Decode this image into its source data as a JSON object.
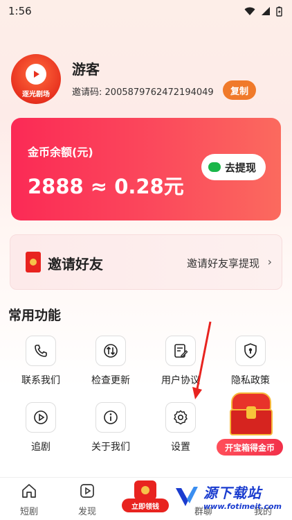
{
  "status_bar": {
    "time": "1:56"
  },
  "profile": {
    "avatar_text": "逐光剧场",
    "username": "游客",
    "invite_label": "邀请码:",
    "invite_code": "2005879762472194049",
    "copy_label": "复制"
  },
  "coin_card": {
    "label": "金币余额(元)",
    "value": "2888 ≈ 0.28元",
    "withdraw_label": "去提现"
  },
  "invite_card": {
    "title": "邀请好友",
    "subtitle": "邀请好友享提现",
    "chevron": "›"
  },
  "functions": {
    "section_title": "常用功能",
    "items": [
      {
        "label": "联系我们",
        "icon": "phone-icon"
      },
      {
        "label": "检查更新",
        "icon": "update-icon"
      },
      {
        "label": "用户协议",
        "icon": "agreement-icon"
      },
      {
        "label": "隐私政策",
        "icon": "privacy-icon"
      },
      {
        "label": "追剧",
        "icon": "play-icon"
      },
      {
        "label": "关于我们",
        "icon": "info-icon"
      },
      {
        "label": "设置",
        "icon": "gear-icon"
      }
    ]
  },
  "treasure": {
    "button_label": "开宝箱得金币"
  },
  "tabbar": {
    "items": [
      {
        "label": "短剧",
        "icon": "home-icon"
      },
      {
        "label": "发现",
        "icon": "discover-icon"
      },
      {
        "label": "立即领钱",
        "icon": "red-envelope-icon"
      },
      {
        "label": "群聊",
        "icon": "chat-icon"
      },
      {
        "label": "我的",
        "icon": "profile-icon"
      }
    ]
  },
  "watermark": {
    "name": "源下载站",
    "url": "www.fotimeit.com"
  },
  "colors": {
    "accent_red": "#fb2a55",
    "accent_orange": "#f07a2a",
    "wechat_green": "#1ab64a",
    "watermark_blue": "#1a3ccf"
  }
}
